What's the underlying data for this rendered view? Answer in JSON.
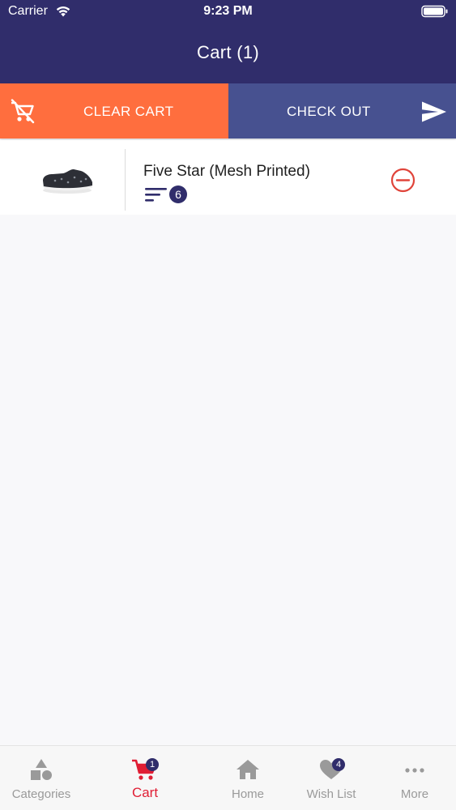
{
  "status_bar": {
    "carrier": "Carrier",
    "time": "9:23 PM",
    "icons": [
      "wifi-icon",
      "battery-icon"
    ]
  },
  "header": {
    "title": "Cart  (1)"
  },
  "actions": {
    "clear_label": "CLEAR CART",
    "checkout_label": "CHECK OUT",
    "clear_color": "#ff6e3e",
    "checkout_color": "#475190"
  },
  "cart_items": [
    {
      "name": "Five Star (Mesh Printed)",
      "quantity": "6",
      "icons": [
        "shoe-thumbnail",
        "quantity-lines-icon",
        "remove-icon"
      ]
    }
  ],
  "tab_bar": {
    "tabs": [
      {
        "label": "Categories",
        "icon": "categories-icon",
        "active": false
      },
      {
        "label": "Cart",
        "icon": "cart-icon",
        "active": true,
        "badge": "1"
      },
      {
        "label": "Home",
        "icon": "home-icon",
        "active": false
      },
      {
        "label": "Wish List",
        "icon": "heart-icon",
        "active": false,
        "badge": "4"
      },
      {
        "label": "More",
        "icon": "more-dots-icon",
        "active": false
      }
    ]
  },
  "colors": {
    "primary": "#302d6b",
    "accent_orange": "#ff6e3e",
    "checkout_blue": "#475190",
    "active_tab": "#e01e34",
    "remove_red": "#e0443a"
  }
}
